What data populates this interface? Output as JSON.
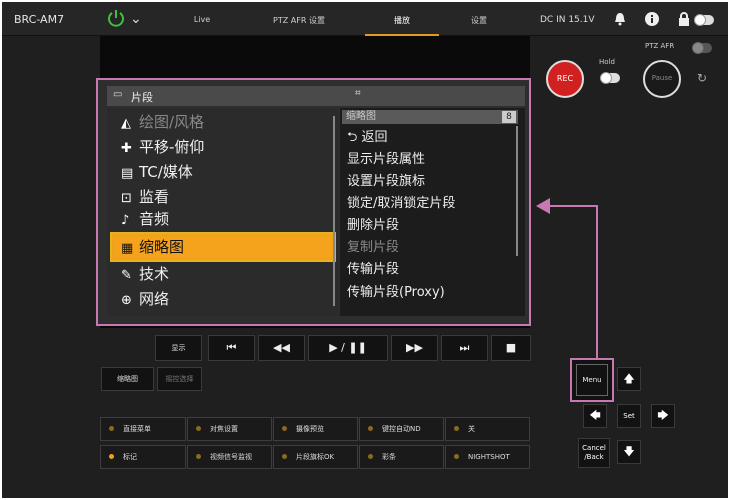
{
  "topbar": {
    "brand": "BRC-AM7",
    "tabs": [
      "Live",
      "PTZ AFR 设置",
      "播放",
      "设置"
    ],
    "active_tab": "播放",
    "dc_in": "DC IN 15.1V"
  },
  "rec": {
    "hold_label": "Hold",
    "rec_label": "REC",
    "ptz_afr_label": "PTZ AFR",
    "pause_label": "Pause"
  },
  "menu": {
    "header": "片段",
    "left_items": [
      {
        "icon": "paint-icon",
        "label": "绘图/风格"
      },
      {
        "icon": "pan-tilt-icon",
        "label": "平移-俯仰"
      },
      {
        "icon": "tc-media-icon",
        "label": "TC/媒体"
      },
      {
        "icon": "monitor-icon",
        "label": "监看"
      },
      {
        "icon": "audio-icon",
        "label": "音频"
      },
      {
        "icon": "thumbnail-icon",
        "label": "缩略图"
      },
      {
        "icon": "technical-icon",
        "label": "技术"
      },
      {
        "icon": "network-icon",
        "label": "网络"
      }
    ],
    "selected": "缩略图",
    "right_header": "缩略图",
    "right_page": "8",
    "right_items": [
      {
        "label": "返回",
        "enabled": true
      },
      {
        "label": "显示片段属性",
        "enabled": true
      },
      {
        "label": "设置片段旗标",
        "enabled": true
      },
      {
        "label": "锁定/取消锁定片段",
        "enabled": true
      },
      {
        "label": "删除片段",
        "enabled": true
      },
      {
        "label": "复制片段",
        "enabled": false
      },
      {
        "label": "传输片段",
        "enabled": true
      },
      {
        "label": "传输片段(Proxy)",
        "enabled": true
      }
    ]
  },
  "transport": {
    "display_label": "显示",
    "thumbnail_label": "缩略图",
    "select_label": "摇控选择",
    "buttons": [
      "prev-icon",
      "rewind-icon",
      "play-pause-icon",
      "forward-icon",
      "next-icon",
      "stop-icon"
    ]
  },
  "function_buttons": [
    [
      "直接菜单",
      "对焦设置",
      "摄像预览",
      "键控自动ND",
      "关"
    ],
    [
      "标记",
      "视频信号监视",
      "片段旗标OK",
      "彩条",
      "NIGHTSHOT"
    ]
  ],
  "controls": {
    "menu": "Menu",
    "set": "Set",
    "cancel": "Cancel\n/Back"
  },
  "colors": {
    "accent": "#f0a21a",
    "highlight": "#c979b2",
    "rec": "#d02020"
  }
}
